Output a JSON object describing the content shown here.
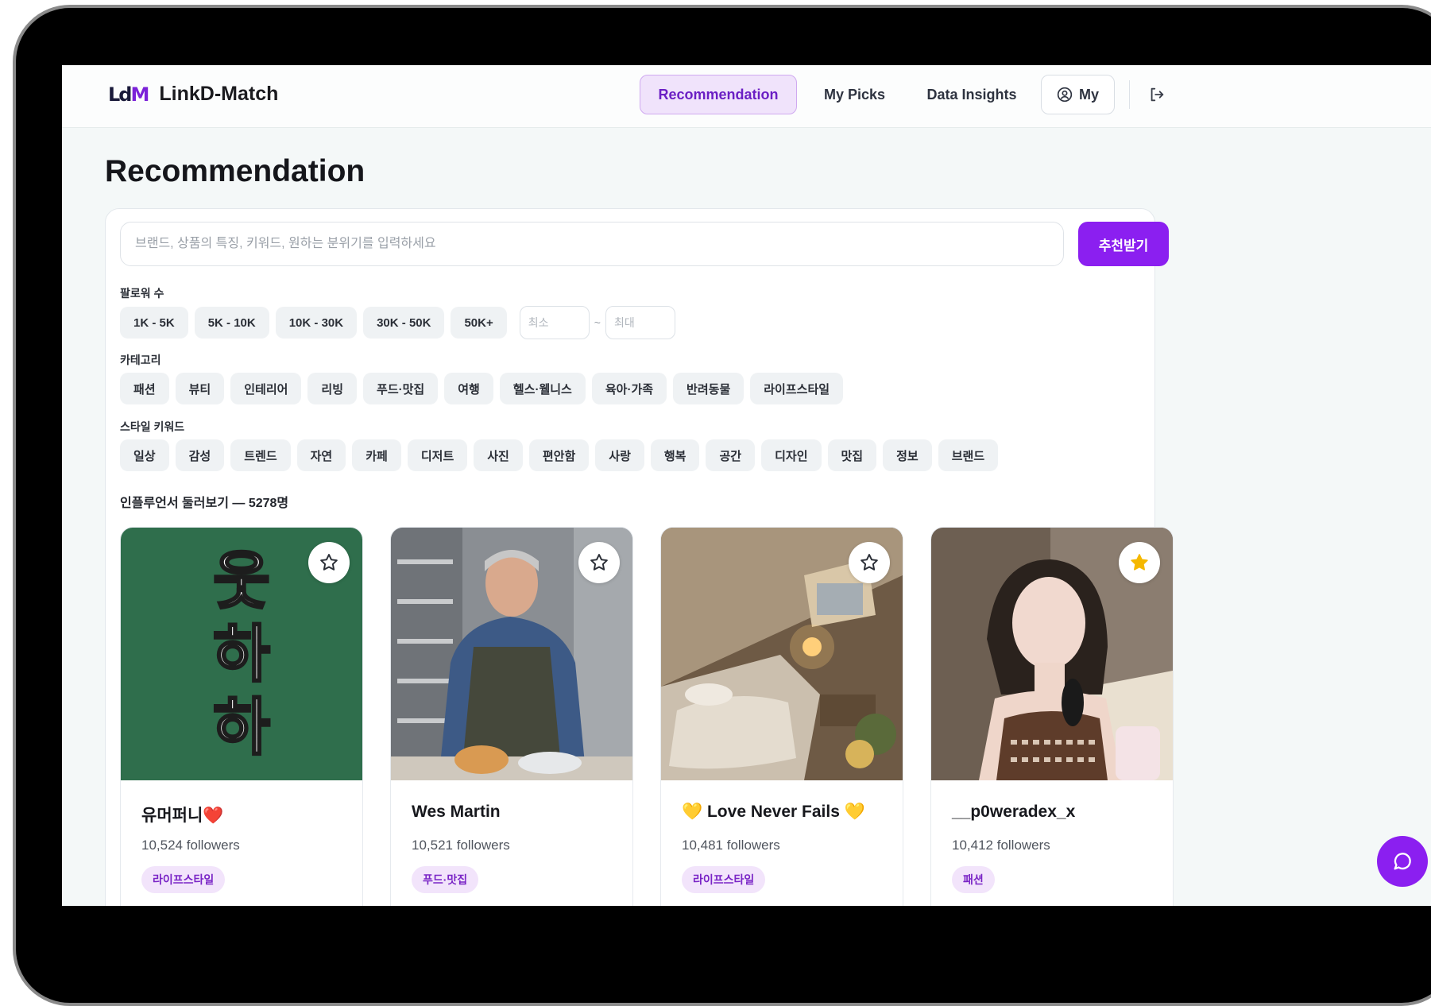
{
  "app": {
    "logo_mark": "LdM",
    "name": "LinkD-Match"
  },
  "nav": {
    "recommendation": "Recommendation",
    "my_picks": "My Picks",
    "data_insights": "Data Insights",
    "my": "My"
  },
  "page": {
    "title": "Recommendation"
  },
  "search": {
    "placeholder": "브랜드, 상품의 특징, 키워드, 원하는 분위기를 입력하세요",
    "button_label": "추천받기"
  },
  "followers_filter": {
    "label": "팔로워 수",
    "options": [
      "1K - 5K",
      "5K - 10K",
      "10K - 30K",
      "30K - 50K",
      "50K+"
    ],
    "min_placeholder": "최소",
    "tilde": "~",
    "max_placeholder": "최대"
  },
  "category_filter": {
    "label": "카테고리",
    "options": [
      "패션",
      "뷰티",
      "인테리어",
      "리빙",
      "푸드·맛집",
      "여행",
      "헬스·웰니스",
      "육아·가족",
      "반려동물",
      "라이프스타일"
    ]
  },
  "style_filter": {
    "label": "스타일 키워드",
    "options": [
      "일상",
      "감성",
      "트렌드",
      "자연",
      "카페",
      "디저트",
      "사진",
      "편안함",
      "사랑",
      "행복",
      "공간",
      "디자인",
      "맛집",
      "정보",
      "브랜드"
    ]
  },
  "browse": {
    "label": "인플루언서 둘러보기 — 5278명"
  },
  "cards": [
    {
      "name": "유머퍼니❤️",
      "followers": "10,524 followers",
      "tag": "라이프스타일",
      "image_text": "웃하하",
      "favorited": false
    },
    {
      "name": "Wes Martin",
      "followers": "10,521 followers",
      "tag": "푸드·맛집",
      "favorited": false
    },
    {
      "name": "💛 Love Never Fails 💛",
      "followers": "10,481 followers",
      "tag": "라이프스타일",
      "favorited": false
    },
    {
      "name": "__p0weradex_x",
      "followers": "10,412 followers",
      "tag": "패션",
      "favorited": true
    }
  ],
  "colors": {
    "accent": "#8b1ff0",
    "star_active": "#f5b800"
  }
}
